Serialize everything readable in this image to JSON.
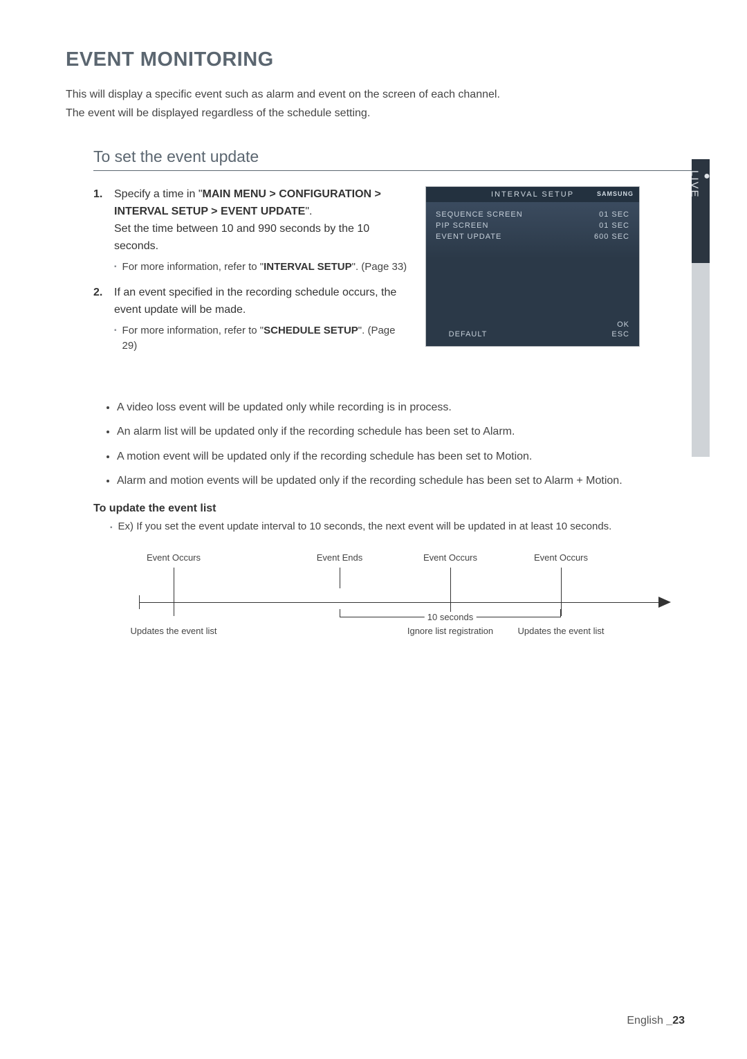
{
  "title": "EVENT MONITORING",
  "intro": {
    "l1": "This will display a specific event such as alarm and event on the screen of each channel.",
    "l2": "The event will be displayed regardless of the schedule setting."
  },
  "subhead": "To set the event update",
  "steps": {
    "s1num": "1.",
    "s1a": "Specify a time in \"",
    "s1b": "MAIN MENU > CONFIGURATION > INTERVAL SETUP > EVENT UPDATE",
    "s1c": "\".",
    "s1d": "Set the time between 10 and 990 seconds by the 10 seconds.",
    "s1sub_a": "For more information, refer to \"",
    "s1sub_b": "INTERVAL SETUP",
    "s1sub_c": "\". (Page 33)",
    "s2num": "2.",
    "s2a": "If an event specified in the recording schedule occurs, the event update will be made.",
    "s2sub_a": "For more information, refer to \"",
    "s2sub_b": "SCHEDULE SETUP",
    "s2sub_c": "\". (Page 29)"
  },
  "panel": {
    "title": "INTERVAL SETUP",
    "brand": "SAMSUNG",
    "rows": [
      {
        "label": "SEQUENCE SCREEN",
        "value": "01 SEC"
      },
      {
        "label": "PIP SCREEN",
        "value": "01 SEC"
      },
      {
        "label": "EVENT UPDATE",
        "value": "600 SEC"
      }
    ],
    "ok": "OK",
    "default": "DEFAULT",
    "esc": "ESC"
  },
  "side_tab": "LIVE",
  "bullets": {
    "b1": "A video loss event will be updated only while recording is in process.",
    "b2": "An alarm list will be updated only if the recording schedule has been set to Alarm.",
    "b3": "A motion event will be updated only if the recording schedule has been set to Motion.",
    "b4": "Alarm and motion events will be updated only if the recording schedule has been set to Alarm + Motion."
  },
  "update_head": "To update the event list",
  "update_sub": "Ex) If you set the event update interval to 10 seconds, the next event will be updated in at least 10 seconds.",
  "timeline": {
    "t1": "Event Occurs",
    "t2": "Event Ends",
    "t3": "Event Occurs",
    "t4": "Event Occurs",
    "mid": "10 seconds",
    "b1": "Updates the event list",
    "b2": "Ignore list registration",
    "b3": "Updates the event list"
  },
  "footer": {
    "lang": "English ",
    "page": "_23"
  }
}
